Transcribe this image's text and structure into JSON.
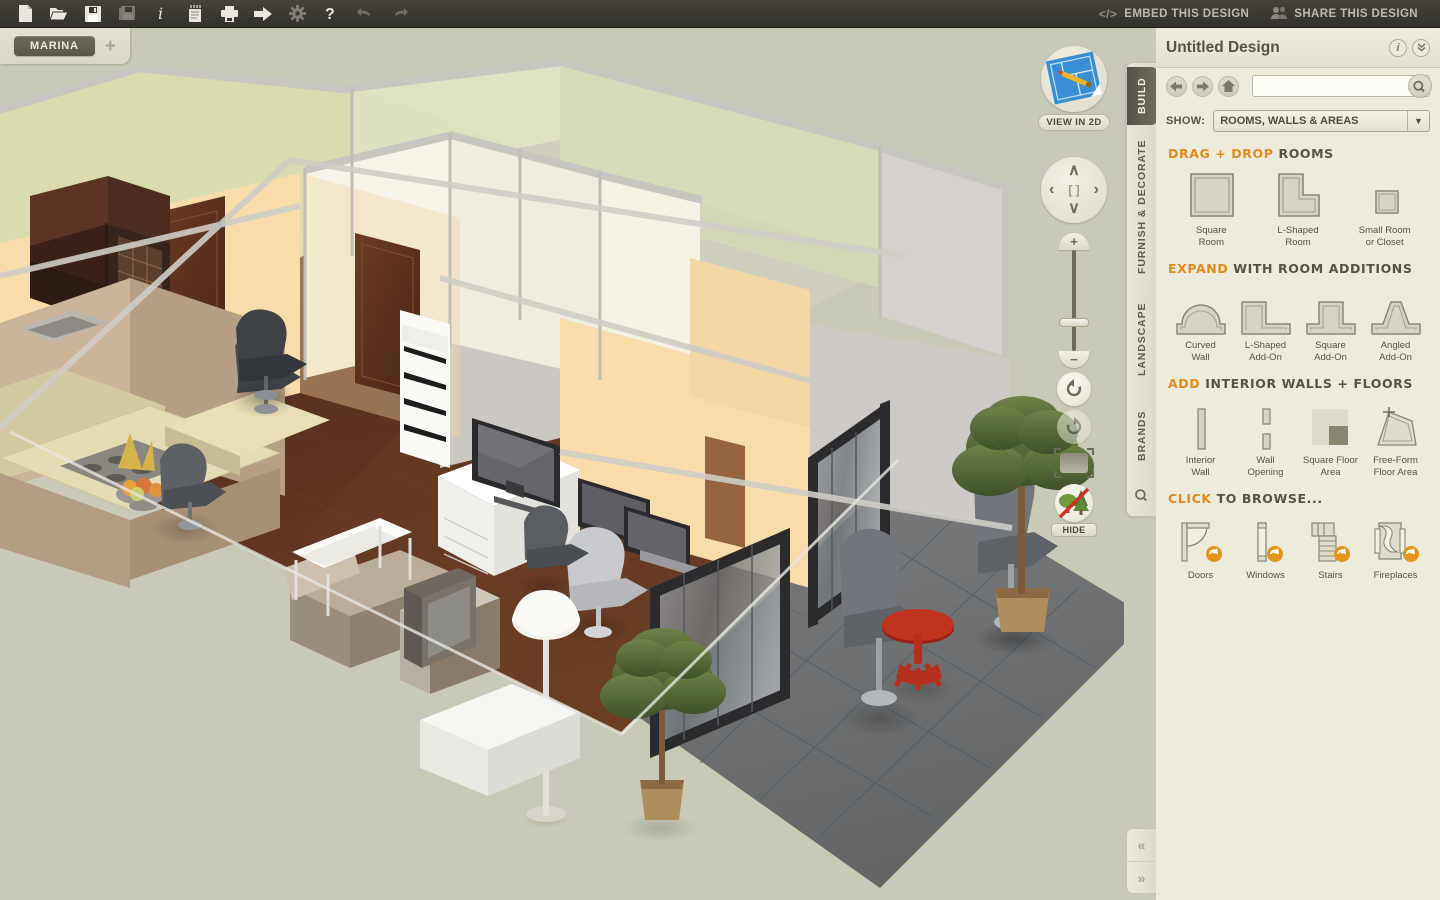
{
  "toolbar": {
    "icons": [
      {
        "name": "new-file-icon",
        "label": "New"
      },
      {
        "name": "open-folder-icon",
        "label": "Open"
      },
      {
        "name": "save-icon",
        "label": "Save"
      },
      {
        "name": "save-as-icon",
        "label": "Save As"
      },
      {
        "name": "info-icon",
        "label": "Info"
      },
      {
        "name": "notes-icon",
        "label": "Notes"
      },
      {
        "name": "print-icon",
        "label": "Print"
      },
      {
        "name": "export-icon",
        "label": "Export"
      },
      {
        "name": "settings-gear-icon",
        "label": "Settings"
      },
      {
        "name": "help-icon",
        "label": "Help"
      },
      {
        "name": "undo-icon",
        "label": "Undo"
      },
      {
        "name": "redo-icon",
        "label": "Redo"
      }
    ],
    "embed_label": "EMBED THIS DESIGN",
    "embed_glyph": "</>",
    "share_label": "SHARE THIS DESIGN"
  },
  "tabbar": {
    "project_tab": "MARINA",
    "add_tab": "+"
  },
  "viewcontrols": {
    "view_2d_label": "VIEW IN 2D",
    "pad": {
      "up": "∧",
      "down": "∨",
      "left": "‹",
      "right": "›",
      "center": "[ ]"
    },
    "zoom_in": "+",
    "zoom_out": "−",
    "rotate_ccw": "↺",
    "rotate_cw": "↻",
    "hide_label": "HIDE"
  },
  "vertical_tabs": [
    {
      "label": "BUILD",
      "active": true
    },
    {
      "label": "FURNISH & DECORATE",
      "active": false
    },
    {
      "label": "LANDSCAPE",
      "active": false
    },
    {
      "label": "BRANDS",
      "active": false
    }
  ],
  "panel": {
    "title": "Untitled Design",
    "info_icon": "i",
    "collapse_icon": "»",
    "nav": {
      "back": "←",
      "forward": "→",
      "home": "⌂"
    },
    "search": {
      "value": "",
      "placeholder": ""
    },
    "show_label": "SHOW:",
    "show_value": "ROOMS, WALLS & AREAS",
    "sections": [
      {
        "head_highlight": "DRAG + DROP",
        "head_rest": "ROOMS",
        "items": [
          {
            "name": "square-room",
            "caption": "Square\nRoom"
          },
          {
            "name": "l-shaped-room",
            "caption": "L-Shaped\nRoom"
          },
          {
            "name": "small-room-or-closet",
            "caption": "Small Room\nor Closet"
          }
        ]
      },
      {
        "head_highlight": "EXPAND",
        "head_rest": "WITH ROOM ADDITIONS",
        "items": [
          {
            "name": "curved-wall",
            "caption": "Curved\nWall"
          },
          {
            "name": "l-shaped-add-on",
            "caption": "L-Shaped\nAdd-On"
          },
          {
            "name": "square-add-on",
            "caption": "Square\nAdd-On"
          },
          {
            "name": "angled-add-on",
            "caption": "Angled\nAdd-On"
          }
        ]
      },
      {
        "head_highlight": "ADD",
        "head_rest": "INTERIOR WALLS + FLOORS",
        "items": [
          {
            "name": "interior-wall",
            "caption": "Interior\nWall"
          },
          {
            "name": "wall-opening",
            "caption": "Wall\nOpening"
          },
          {
            "name": "square-floor-area",
            "caption": "Square Floor\nArea"
          },
          {
            "name": "free-form-floor-area",
            "caption": "Free-Form\nFloor Area"
          }
        ]
      },
      {
        "head_highlight": "CLICK",
        "head_rest": "TO BROWSE...",
        "items": [
          {
            "name": "doors",
            "caption": "Doors"
          },
          {
            "name": "windows",
            "caption": "Windows"
          },
          {
            "name": "stairs",
            "caption": "Stairs"
          },
          {
            "name": "fireplaces",
            "caption": "Fireplaces"
          }
        ]
      }
    ]
  },
  "pager": {
    "prev": "«",
    "next": "»"
  },
  "colors": {
    "toolbar_bg": "#3a3832",
    "canvas_bg": "#c9c9b8",
    "panel_bg": "#edebdc",
    "accent_orange": "#e08a1e",
    "text_dark": "#55524a",
    "tab_active_bg": "#5f5c4f"
  },
  "scene": {
    "description": "Isometric 3D rendering of a furnished apartment floor plan",
    "wall_colors": [
      "#f6d9a8",
      "#e3e4b9",
      "#d9dcc0",
      "#f2efe4",
      "#cfcbc8"
    ],
    "floor_colors": [
      "#5c3222",
      "#7a4a2e"
    ],
    "balcony_floor": "#6e7072"
  }
}
